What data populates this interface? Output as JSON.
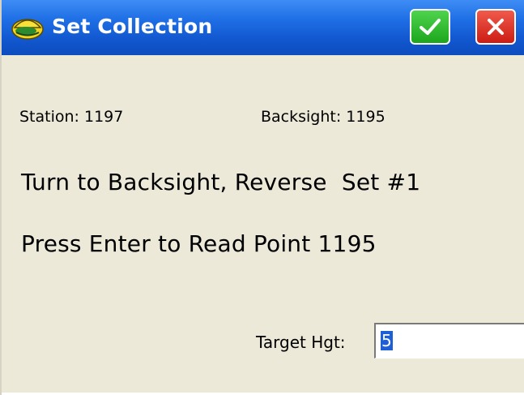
{
  "window": {
    "title": "Set Collection",
    "ok_icon": "check-icon",
    "close_icon": "close-icon",
    "app_icon": "surveyor-helmet-icon",
    "colors": {
      "titlebar": "#1F6FE6",
      "ok": "#22B022",
      "close": "#D42A1E",
      "background": "#ECE9D8"
    }
  },
  "info": {
    "station": "Station: 1197",
    "backsight": "Backsight: 1195"
  },
  "instructions": {
    "line1": "Turn to Backsight, Reverse  Set #1",
    "line2": "Press Enter to Read Point 1195"
  },
  "target": {
    "label": "Target Hgt:",
    "value": "5"
  }
}
